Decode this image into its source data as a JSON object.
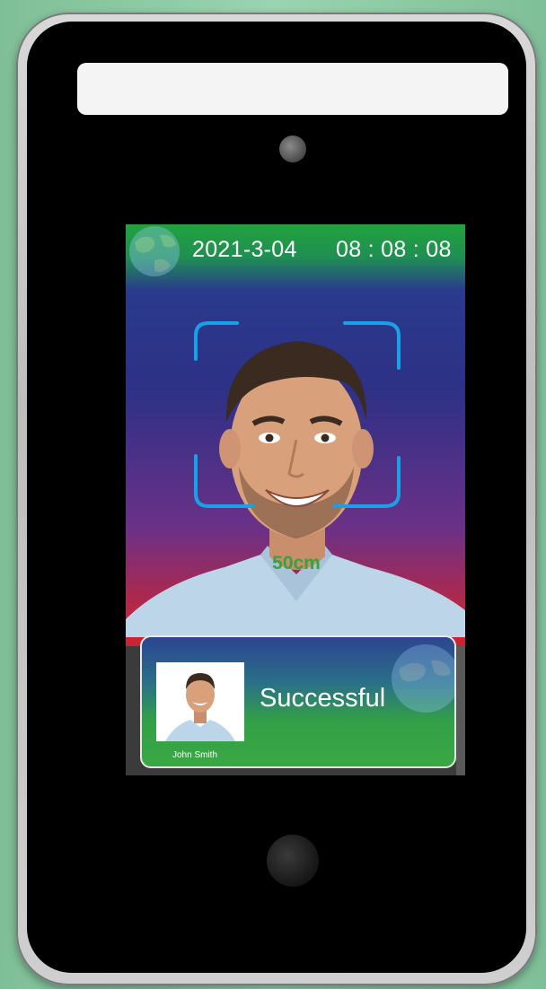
{
  "screen": {
    "date": "2021-3-04",
    "time": "08 : 08 : 08",
    "distance": "50cm"
  },
  "result": {
    "status": "Successful",
    "name": "John Smith"
  },
  "colors": {
    "frame_blue": "#1aa0e6",
    "distance_green": "#3aa13f",
    "card_top": "#2d4590",
    "card_bottom": "#39a844"
  }
}
